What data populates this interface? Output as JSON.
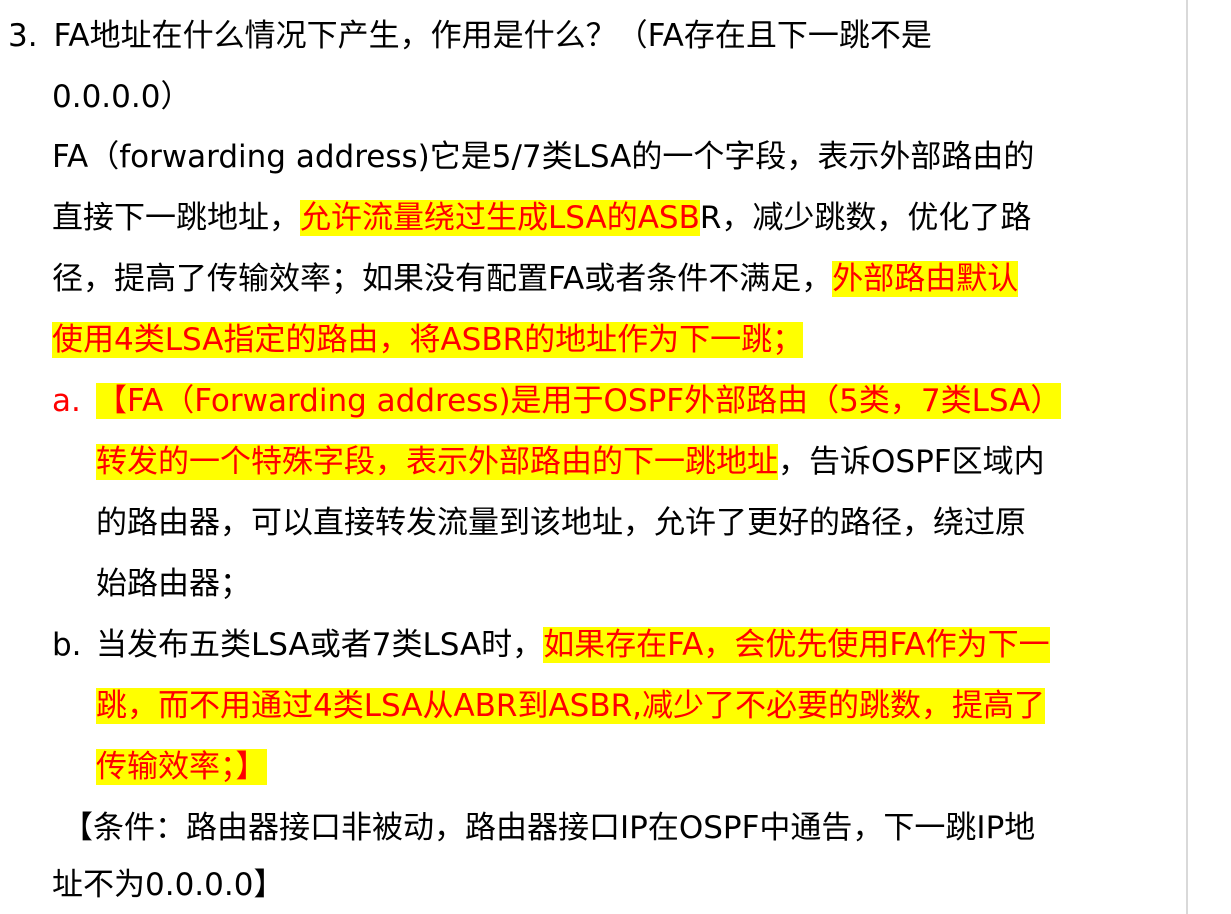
{
  "question": {
    "number": "3.",
    "line1": "FA地址在什么情况下产生，作用是什么？（FA存在且下一跳不是",
    "line2": "0.0.0.0）"
  },
  "intro": {
    "l1": "FA（forwarding address)它是5/7类LSA的一个字段，表示外部路由的",
    "l2_pre": "直接下一跳地址，",
    "l2_hl": "允许流量绕过生成LSA的ASB",
    "l2_post": "R，减少跳数，优化了路",
    "l3_pre": "径，提高了传输效率；如果没有配置FA或者条件不满足，",
    "l3_hl": "外部路由默认",
    "l4_hl": "使用4类LSA指定的路由，将ASBR的地址作为下一跳；"
  },
  "item_a": {
    "marker": "a.",
    "l1_hl": "【FA（Forwarding address)是用于OSPF外部路由（5类，7类LSA）",
    "l2_hl": "转发的一个特殊字段，表示外部路由的下一跳地址",
    "l2_post": "，告诉OSPF区域内",
    "l3": "的路由器，可以直接转发流量到该地址，允许了更好的路径，绕过原",
    "l4": "始路由器；"
  },
  "item_b": {
    "marker": "b.",
    "l1_pre": "当发布五类LSA或者7类LSA时，",
    "l1_hl": "如果存在FA，会优先使用FA作为下一",
    "l2_hl": "跳，而不用通过4类LSA从ABR到ASBR,减少了不必要的跳数，提高了",
    "l3_hl": "传输效率；】"
  },
  "condition": {
    "l1": "【条件：路由器接口非被动，路由器接口IP在OSPF中通告，下一跳IP地",
    "l2": "址不为0.0.0.0】"
  },
  "colors": {
    "highlight": "#ffff00",
    "red_text": "#ff0000"
  }
}
